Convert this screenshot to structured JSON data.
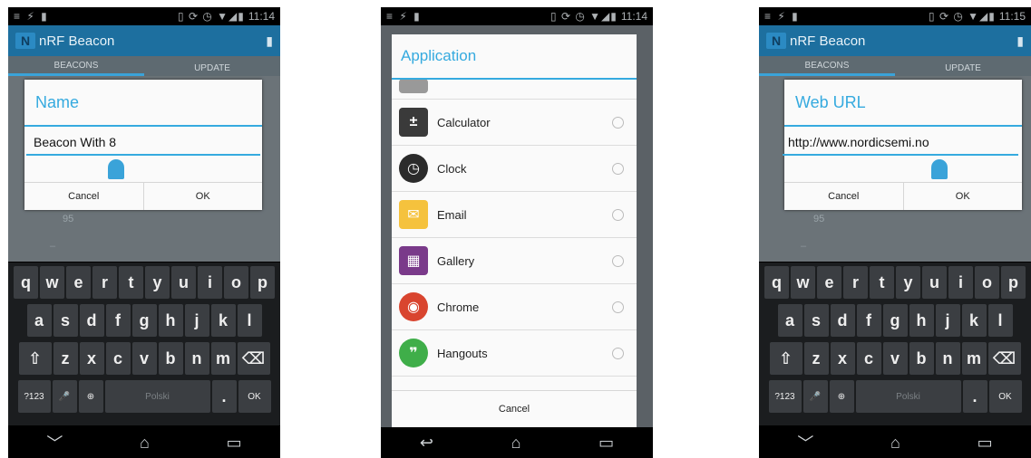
{
  "status": {
    "time1": "11:14",
    "time2": "11:14",
    "time3": "11:15",
    "left_icons": "≡ ⚡ ▮",
    "right_icons": "▯ ⟳ ◷ ▼◢▮"
  },
  "actionbar": {
    "title": "nRF Beacon",
    "logo": "N"
  },
  "tabs": {
    "beacons": "BEACONS",
    "update": "UPDATE"
  },
  "background": {
    "value": "95",
    "dash": "–"
  },
  "dialog_name": {
    "title": "Name",
    "value": "Beacon With 8",
    "cancel": "Cancel",
    "ok": "OK"
  },
  "dialog_url": {
    "title": "Web URL",
    "value": "http://www.nordicsemi.no",
    "cancel": "Cancel",
    "ok": "OK"
  },
  "keyboard": {
    "row1": [
      "q",
      "w",
      "e",
      "r",
      "t",
      "y",
      "u",
      "i",
      "o",
      "p"
    ],
    "row2": [
      "a",
      "s",
      "d",
      "f",
      "g",
      "h",
      "j",
      "k",
      "l"
    ],
    "row3": [
      "⇧",
      "z",
      "x",
      "c",
      "v",
      "b",
      "n",
      "m",
      "⌫"
    ],
    "sym": "?123",
    "mic": "🎤",
    "globe": "⊕",
    "space": "Polski",
    "period": ".",
    "enter": "OK"
  },
  "navbar": {
    "back": "﹀",
    "back_alt": "↩",
    "home": "⌂",
    "recents": "▭"
  },
  "app_chooser": {
    "title": "Application",
    "items": [
      {
        "name": "Calculator",
        "icon": "calculator-icon",
        "color": "#3a3a3a",
        "glyph": "±"
      },
      {
        "name": "Clock",
        "icon": "clock-icon",
        "color": "#2b2b2b",
        "glyph": "◷"
      },
      {
        "name": "Email",
        "icon": "email-icon",
        "color": "#f5c23d",
        "glyph": "✉"
      },
      {
        "name": "Gallery",
        "icon": "gallery-icon",
        "color": "#7a3a8a",
        "glyph": "▦"
      },
      {
        "name": "Chrome",
        "icon": "chrome-icon",
        "color": "#d9452f",
        "glyph": "◉"
      },
      {
        "name": "Hangouts",
        "icon": "hangouts-icon",
        "color": "#3fae49",
        "glyph": "❞"
      }
    ],
    "cancel": "Cancel"
  },
  "colors": {
    "accent": "#35aadf",
    "actionbar": "#1d6f9f"
  }
}
